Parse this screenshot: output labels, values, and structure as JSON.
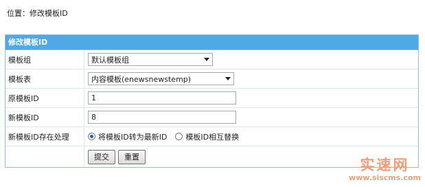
{
  "breadcrumb": {
    "prefix": "位置：",
    "current": "修改模板ID"
  },
  "panel": {
    "title": "修改模板ID",
    "rows": {
      "group": {
        "label": "模板组",
        "selected": "默认模板组"
      },
      "table": {
        "label": "模板表",
        "selected": "内容模板(enewsnewstemp)"
      },
      "old_id": {
        "label": "原模板ID",
        "value": "1"
      },
      "new_id": {
        "label": "新模板ID",
        "value": "8"
      },
      "exists": {
        "label": "新模板ID存在处理",
        "option1": "将模板ID转为最新ID",
        "option2": "模板ID相互替换",
        "selected": "option1"
      }
    },
    "buttons": {
      "submit": "提交",
      "reset": "重置"
    }
  },
  "watermark": {
    "title": "实速网",
    "url": "www.siscms.com"
  }
}
